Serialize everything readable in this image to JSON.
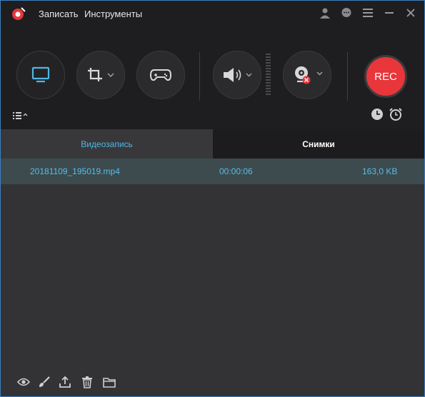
{
  "menu": {
    "record": "Записать",
    "tools": "Инструменты"
  },
  "toolbar": {
    "screen_icon": "monitor-icon",
    "crop_icon": "crop-icon",
    "game_icon": "gamepad-icon",
    "audio_icon": "speaker-icon",
    "webcam_icon": "webcam-icon",
    "rec_label": "REC"
  },
  "tabs": {
    "video": "Видеозапись",
    "snapshots": "Снимки"
  },
  "files": [
    {
      "name": "20181109_195019.mp4",
      "duration": "00:00:06",
      "size": "163,0 KB"
    }
  ],
  "colors": {
    "accent": "#4fb7e4",
    "rec": "#e8363a",
    "row_text": "#55bfe8"
  }
}
